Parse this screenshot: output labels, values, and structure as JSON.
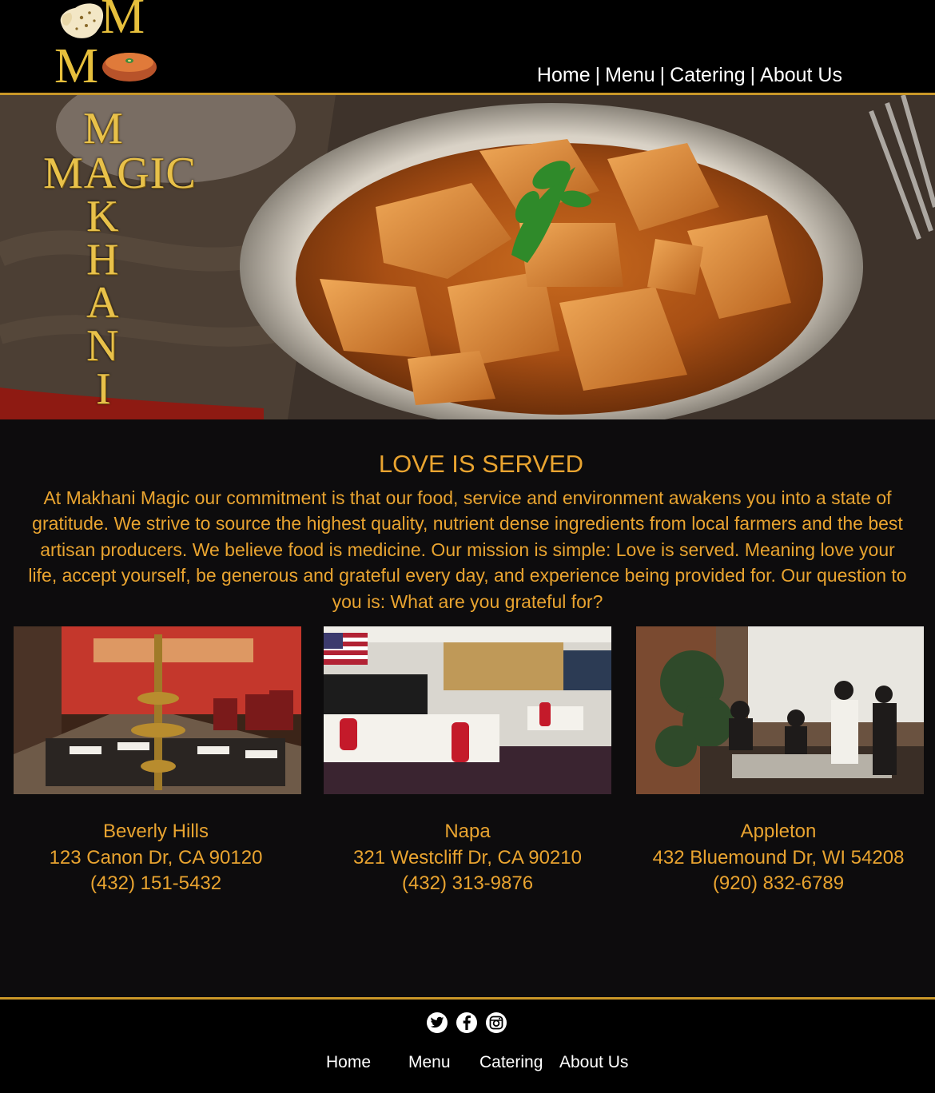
{
  "header": {
    "logo_text": "MM",
    "nav": [
      {
        "label": "Home"
      },
      {
        "label": "Menu"
      },
      {
        "label": "Catering"
      },
      {
        "label": "About Us"
      }
    ],
    "nav_separator": "|"
  },
  "hero": {
    "title_line1": "M",
    "title_line2": "MAGIC",
    "title_vertical": [
      "A",
      "K",
      "H",
      "A",
      "N",
      "I"
    ]
  },
  "mission": {
    "title": "LOVE IS SERVED",
    "text": "At Makhani Magic our commitment is that our food, service and environment awakens you into a state of gratitude. We strive to source the highest quality, nutrient dense ingredients from local farmers and the best artisan producers. We believe food is medicine. Our mission is simple: Love is served. Meaning love your life, accept yourself, be generous and grateful every day, and experience being provided for. Our question to you is: What are you grateful for?"
  },
  "locations": [
    {
      "name": "Beverly Hills",
      "address": "123 Canon Dr, CA 90120",
      "phone": "(432) 151-5432"
    },
    {
      "name": "Napa",
      "address": "321 Westcliff Dr, CA 90210",
      "phone": "(432) 313-9876"
    },
    {
      "name": "Appleton",
      "address": "432 Bluemound Dr, WI 54208",
      "phone": "(920) 832-6789"
    }
  ],
  "footer": {
    "social": [
      "twitter-icon",
      "facebook-icon",
      "instagram-icon"
    ],
    "nav": [
      {
        "label": "Home"
      },
      {
        "label": "Menu"
      },
      {
        "label": "Catering"
      },
      {
        "label": "About Us"
      }
    ]
  },
  "colors": {
    "gold": "#e9a430",
    "logo_gold": "#e6bf3c",
    "line": "#c99728",
    "background": "#0d0c0d"
  }
}
